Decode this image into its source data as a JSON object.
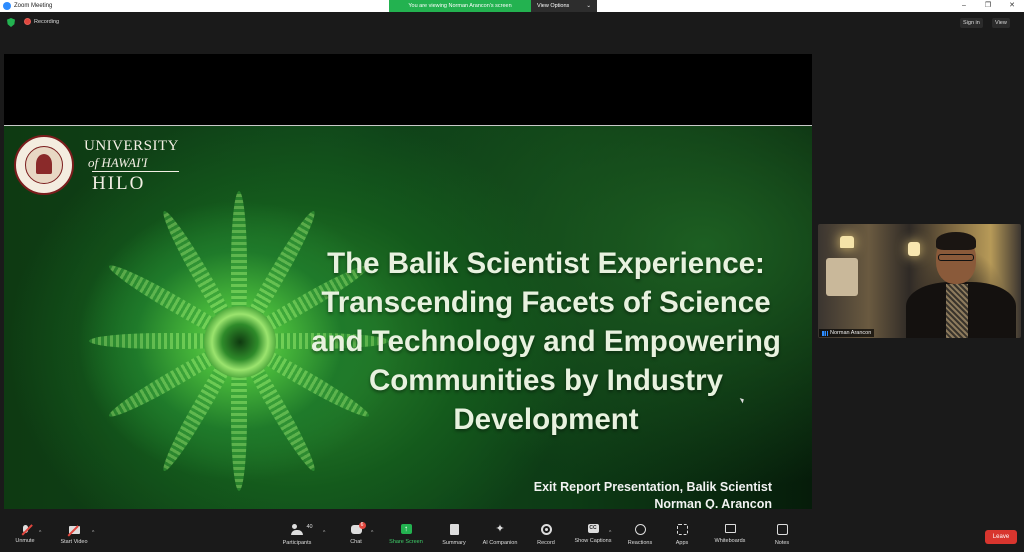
{
  "window": {
    "title": "Zoom Meeting",
    "controls": [
      "–",
      "❐",
      "✕"
    ]
  },
  "share_banner": {
    "message": "You are viewing Norman Arancon's screen",
    "view_options": "View Options",
    "caret": "⌄"
  },
  "topbar": {
    "recording": "Recording",
    "sign_in": "Sign in",
    "view": "View"
  },
  "slide": {
    "logo_text": [
      "UNIVERSITY",
      "of HAWAI'I",
      "HILO"
    ],
    "title_lines": [
      "The Balik Scientist Experience:",
      "Transcending Facets of Science",
      "and Technology and Empowering",
      "Communities by Industry",
      "Development"
    ],
    "subtitle_lines": [
      "Exit Report Presentation, Balik Scientist",
      "Norman Q. Arancon"
    ]
  },
  "participant": {
    "name": "Norman Arancon"
  },
  "toolbar": {
    "unmute": "Unmute",
    "start_video": "Start Video",
    "participants": "Participants",
    "participants_count": "40",
    "chat": "Chat",
    "chat_badge": "6",
    "share_screen": "Share Screen",
    "summary": "Summary",
    "ai_companion": "AI Companion",
    "record": "Record",
    "show_captions": "Show Captions",
    "cc": "CC",
    "reactions": "Reactions",
    "apps": "Apps",
    "whiteboards": "Whiteboards",
    "notes": "Notes",
    "leave": "Leave",
    "caret": "^"
  },
  "colors": {
    "zoom_blue": "#2d8cff",
    "share_green": "#23b250",
    "leave_red": "#d8352e",
    "background": "#1a1a1a"
  },
  "icons": [
    "zoom-app-icon",
    "shield-icon",
    "recording-dot-icon",
    "mic-muted-icon",
    "video-off-icon",
    "participants-icon",
    "chat-icon",
    "share-screen-icon",
    "summary-icon",
    "ai-companion-icon",
    "record-icon",
    "captions-icon",
    "reactions-icon",
    "apps-icon",
    "whiteboards-icon",
    "notes-icon"
  ]
}
